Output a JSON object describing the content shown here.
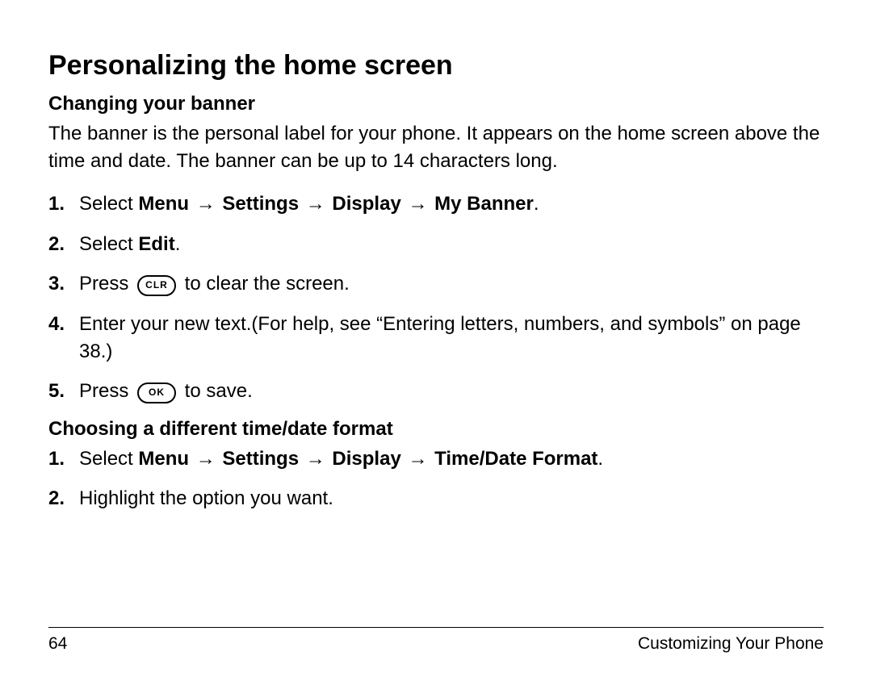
{
  "title": "Personalizing the home screen",
  "section1": {
    "heading": "Changing your banner",
    "paragraph": "The banner is the personal label for your phone. It appears on the home screen above the time and date. The banner can be up to 14 characters long.",
    "steps": {
      "n1": "1.",
      "s1_pre": "Select ",
      "s1_menu": "Menu",
      "s1_settings": "Settings",
      "s1_display": "Display",
      "s1_mybanner": "My Banner",
      "s1_period": ".",
      "arrow": "→",
      "n2": "2.",
      "s2_pre": "Select ",
      "s2_edit": "Edit",
      "s2_period": ".",
      "n3": "3.",
      "s3_pre": "Press ",
      "s3_key": "CLR",
      "s3_post": " to clear the screen.",
      "n4": "4.",
      "s4_text": "Enter your new text.(For help, see “Entering letters, numbers, and symbols” on page 38.)",
      "n5": "5.",
      "s5_pre": "Press ",
      "s5_key": "OK",
      "s5_post": " to save."
    }
  },
  "section2": {
    "heading": "Choosing a different time/date format",
    "steps": {
      "n1": "1.",
      "s1_pre": "Select ",
      "s1_menu": "Menu",
      "s1_settings": "Settings",
      "s1_display": "Display",
      "s1_timedate": "Time/Date Format",
      "s1_period": ".",
      "arrow": "→",
      "n2": "2.",
      "s2_text": "Highlight the option you want."
    }
  },
  "footer": {
    "page": "64",
    "chapter": "Customizing Your Phone"
  }
}
